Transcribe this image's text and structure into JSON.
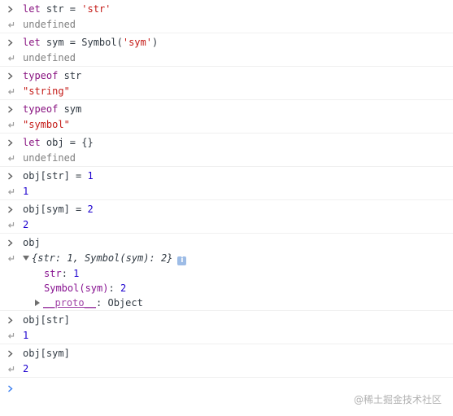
{
  "entries": [
    {
      "input": [
        [
          "kw",
          "let"
        ],
        [
          "plain",
          " str = "
        ],
        [
          "str",
          "'str'"
        ]
      ],
      "output": [
        [
          "undef",
          "undefined"
        ]
      ]
    },
    {
      "input": [
        [
          "kw",
          "let"
        ],
        [
          "plain",
          " sym = Symbol("
        ],
        [
          "str",
          "'sym'"
        ],
        [
          "plain",
          ")"
        ]
      ],
      "output": [
        [
          "undef",
          "undefined"
        ]
      ]
    },
    {
      "input": [
        [
          "kw",
          "typeof"
        ],
        [
          "plain",
          " str"
        ]
      ],
      "output": [
        [
          "str",
          "\"string\""
        ]
      ]
    },
    {
      "input": [
        [
          "kw",
          "typeof"
        ],
        [
          "plain",
          " sym"
        ]
      ],
      "output": [
        [
          "str",
          "\"symbol\""
        ]
      ]
    },
    {
      "input": [
        [
          "kw",
          "let"
        ],
        [
          "plain",
          " obj = {}"
        ]
      ],
      "output": [
        [
          "undef",
          "undefined"
        ]
      ]
    },
    {
      "input": [
        [
          "plain",
          "obj[str] = "
        ],
        [
          "num",
          "1"
        ]
      ],
      "output": [
        [
          "num",
          "1"
        ]
      ]
    },
    {
      "input": [
        [
          "plain",
          "obj[sym] = "
        ],
        [
          "num",
          "2"
        ]
      ],
      "output": [
        [
          "num",
          "2"
        ]
      ]
    }
  ],
  "obj_entry": {
    "input": "obj",
    "preview": "{str: 1, Symbol(sym): 2}",
    "info_icon": "i",
    "props": [
      {
        "key": "str",
        "value": "1"
      },
      {
        "key": "Symbol(sym)",
        "value": "2"
      }
    ],
    "proto_key": "__proto__",
    "proto_value": "Object"
  },
  "tail_entries": [
    {
      "input": "obj[str]",
      "output": "1"
    },
    {
      "input": "obj[sym]",
      "output": "2"
    }
  ],
  "watermark": "@稀土掘金技术社区",
  "icons": {
    "input_prompt": "chevron-right-icon",
    "output_prompt": "return-arrow-icon"
  },
  "colors": {
    "keyword": "#881280",
    "string": "#c41a16",
    "number": "#1c00cf",
    "prompt_active": "#367cf1"
  }
}
